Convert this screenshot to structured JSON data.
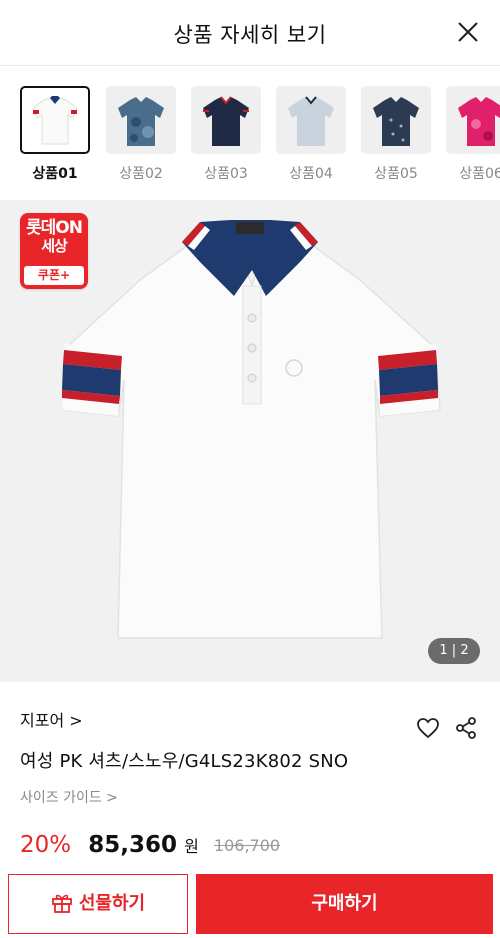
{
  "header": {
    "title": "상품 자세히 보기",
    "close_icon": "close-icon"
  },
  "thumbnails": [
    {
      "label": "상품01",
      "active": true,
      "color": "#ffffff"
    },
    {
      "label": "상품02",
      "active": false,
      "color": "#4a6d8c"
    },
    {
      "label": "상품03",
      "active": false,
      "color": "#1f2a44"
    },
    {
      "label": "상품04",
      "active": false,
      "color": "#c9d3de"
    },
    {
      "label": "상품05",
      "active": false,
      "color": "#2c3a52"
    },
    {
      "label": "상품06",
      "active": false,
      "color": "#e0206a"
    }
  ],
  "badge": {
    "line1": "롯데ON",
    "line2": "세상",
    "line3": "쿠폰+"
  },
  "pager": {
    "text": "1 | 2"
  },
  "product": {
    "brand": "지포어 >",
    "name": "여성 PK 셔츠/스노우/G4LS23K802 SNO",
    "size_guide": "사이즈 가이드 >"
  },
  "price": {
    "discount": "20%",
    "sale": "85,360",
    "currency": "원",
    "original": "106,700"
  },
  "buttons": {
    "gift": "선물하기",
    "buy": "구매하기"
  },
  "colors": {
    "accent": "#e8262a",
    "navy": "#1e3a6e"
  }
}
